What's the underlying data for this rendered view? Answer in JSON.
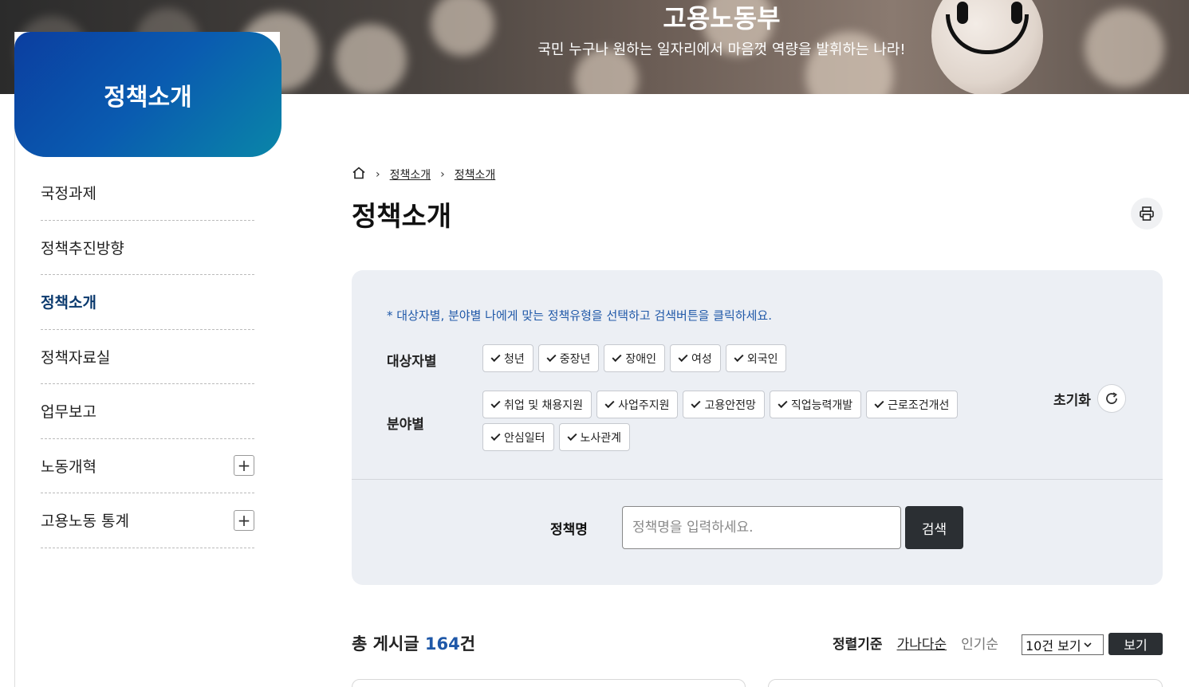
{
  "banner": {
    "title": "고용노동부",
    "subtitle": "국민 누구나 원하는 일자리에서 마음껏 역량을 발휘하는 나라!"
  },
  "sidebar": {
    "title": "정책소개",
    "items": [
      {
        "label": "국정과제",
        "active": false,
        "expandable": false
      },
      {
        "label": "정책추진방향",
        "active": false,
        "expandable": false
      },
      {
        "label": "정책소개",
        "active": true,
        "expandable": false
      },
      {
        "label": "정책자료실",
        "active": false,
        "expandable": false
      },
      {
        "label": "업무보고",
        "active": false,
        "expandable": false
      },
      {
        "label": "노동개혁",
        "active": false,
        "expandable": true
      },
      {
        "label": "고용노동 통계",
        "active": false,
        "expandable": true
      }
    ],
    "expand_symbol": "+"
  },
  "breadcrumb": {
    "items": [
      "정책소개",
      "정책소개"
    ],
    "separator": "›"
  },
  "page": {
    "title": "정책소개"
  },
  "filter": {
    "notice": "* 대상자별, 분야별 나에게 맞는 정책유형을 선택하고 검색버튼을 클릭하세요.",
    "target_label": "대상자별",
    "target_options": [
      "청년",
      "중장년",
      "장애인",
      "여성",
      "외국인"
    ],
    "field_label": "분야별",
    "field_options": [
      "취업 및 채용지원",
      "사업주지원",
      "고용안전망",
      "직업능력개발",
      "근로조건개선",
      "안심일터",
      "노사관계"
    ],
    "reset_label": "초기화",
    "search_label": "정책명",
    "search_placeholder": "정책명을 입력하세요.",
    "search_button": "검색"
  },
  "results": {
    "total_prefix": "총 게시글 ",
    "total_count": "164",
    "total_suffix": "건",
    "sort_label": "정렬기준",
    "sort_options": [
      "가나다순",
      "인기순"
    ],
    "per_page": "10건 보기",
    "view_button": "보기"
  }
}
